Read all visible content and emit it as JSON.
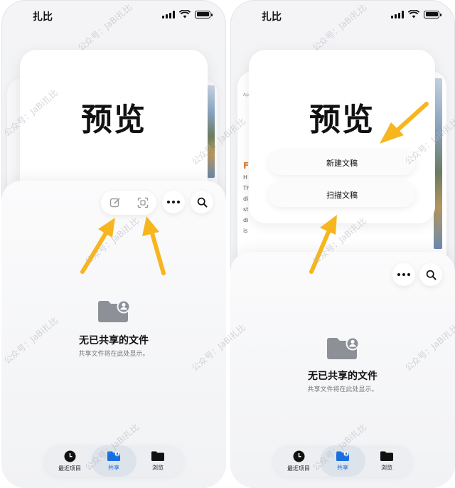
{
  "left": {
    "status": {
      "time": "扎比"
    },
    "preview_title": "预览",
    "empty": {
      "title": "无已共享的文件",
      "subtitle": "共享文件将在此处显示。"
    },
    "tabs": [
      {
        "label": "最近项目",
        "icon": "clock-icon"
      },
      {
        "label": "共享",
        "icon": "shared-folder-icon",
        "active": true
      },
      {
        "label": "浏览",
        "icon": "folder-icon"
      }
    ],
    "toolbar_icons": [
      "compose-icon",
      "scan-icon",
      "more-icon",
      "search-icon"
    ]
  },
  "right": {
    "status": {
      "time": "扎比"
    },
    "preview_title": "预览",
    "menu": {
      "new_doc": "新建文稿",
      "scan_doc": "扫描文稿"
    },
    "doc_peek": {
      "heading": "F",
      "lines": [
        "H",
        "Th",
        "di",
        "st",
        "di",
        "is"
      ],
      "top_text": "Ap"
    },
    "empty": {
      "title": "无已共享的文件",
      "subtitle": "共享文件将在此处显示。"
    },
    "tabs": [
      {
        "label": "最近项目",
        "icon": "clock-icon"
      },
      {
        "label": "共享",
        "icon": "shared-folder-icon",
        "active": true
      },
      {
        "label": "浏览",
        "icon": "folder-icon"
      }
    ]
  },
  "watermark": "公众号：JaBi扎比",
  "colors": {
    "arrow": "#f7b51e",
    "accent": "#1a6fe0",
    "folder": "#8e9097"
  }
}
